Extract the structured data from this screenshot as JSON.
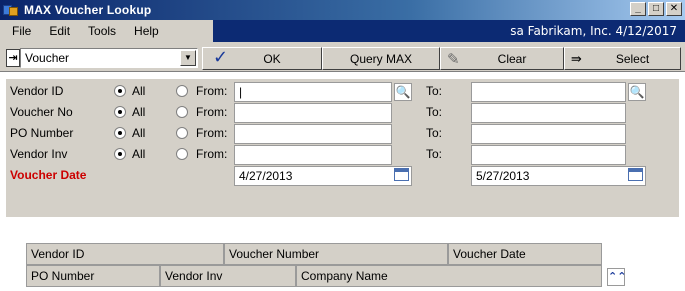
{
  "window": {
    "title": "MAX Voucher Lookup",
    "minimize": "_",
    "maximize": "□",
    "close": "✕"
  },
  "menu": {
    "items": [
      "File",
      "Edit",
      "Tools",
      "Help"
    ],
    "company_info": "sa  Fabrikam, Inc.  4/12/2017"
  },
  "toolbar": {
    "lookup_value": "Voucher",
    "ok_label": "OK",
    "query_label": "Query MAX",
    "clear_label": "Clear",
    "select_label": "Select"
  },
  "filters": [
    {
      "label": "Vendor ID",
      "all": "All",
      "from": "From:",
      "from_value": "|",
      "to": "To:",
      "to_value": ""
    },
    {
      "label": "Voucher No",
      "all": "All",
      "from": "From:",
      "from_value": "",
      "to": "To:",
      "to_value": ""
    },
    {
      "label": "PO Number",
      "all": "All",
      "from": "From:",
      "from_value": "",
      "to": "To:",
      "to_value": ""
    },
    {
      "label": "Vendor Inv",
      "all": "All",
      "from": "From:",
      "from_value": "",
      "to": "To:",
      "to_value": ""
    }
  ],
  "voucher_date": {
    "label": "Voucher Date",
    "from_value": "4/27/2013",
    "to_value": "5/27/2013"
  },
  "grid": {
    "row1": [
      "Vendor ID",
      "Voucher Number",
      "Voucher Date"
    ],
    "row2": [
      "PO Number",
      "Vendor Inv",
      "Company Name"
    ]
  }
}
